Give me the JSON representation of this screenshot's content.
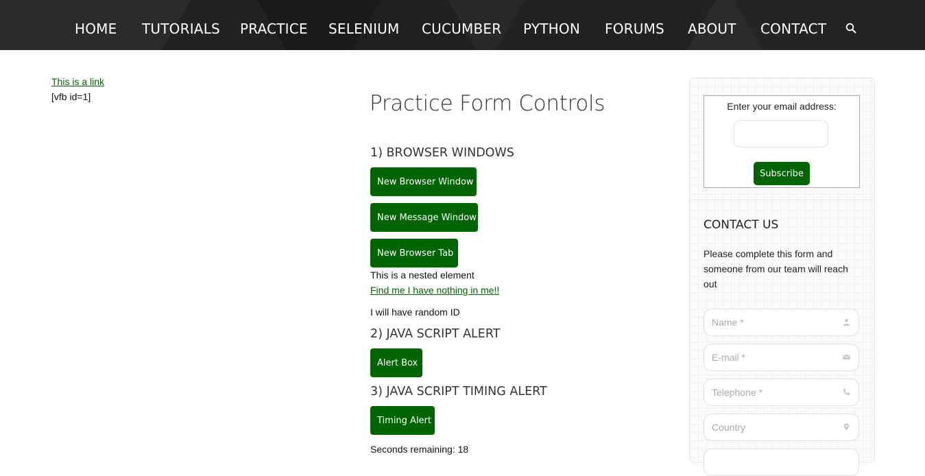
{
  "nav": {
    "items": [
      {
        "label": "HOME"
      },
      {
        "label": "TUTORIALS"
      },
      {
        "label": "PRACTICE"
      },
      {
        "label": "SELENIUM"
      },
      {
        "label": "CUCUMBER"
      },
      {
        "label": "PYTHON"
      },
      {
        "label": "FORUMS"
      },
      {
        "label": "ABOUT"
      },
      {
        "label": "CONTACT"
      }
    ],
    "search_icon": "search-icon"
  },
  "left": {
    "link_text": "This is a link",
    "shortcode_text": "[vfb id=1]"
  },
  "main": {
    "title": "Practice Form Controls",
    "sections": {
      "browser_windows": "1) BROWSER WINDOWS",
      "js_alert": "2) JAVA SCRIPT ALERT",
      "js_timing_alert": "3) JAVA SCRIPT TIMING ALERT"
    },
    "buttons": {
      "new_browser_window": "New Browser Window",
      "new_message_window": "New Message Window",
      "new_browser_tab": "New Browser Tab",
      "alert_box": "Alert Box",
      "timing_alert": "Timing Alert"
    },
    "nested_text": "This is a nested element",
    "find_me_link": "Find me I have nothing in me!!",
    "random_id_text": "I will have random ID",
    "seconds_remaining": "Seconds remaining: 18"
  },
  "sidebar": {
    "subscribe": {
      "label": "Enter your email address:",
      "email_value": "",
      "button": "Subscribe"
    },
    "contact": {
      "title": "CONTACT US",
      "description": "Please complete this form and someone from our team will reach out",
      "fields": [
        {
          "placeholder": "Name *",
          "icon": "user-icon"
        },
        {
          "placeholder": "E-mail *",
          "icon": "envelope-icon"
        },
        {
          "placeholder": "Telephone *",
          "icon": "phone-icon"
        },
        {
          "placeholder": "Country",
          "icon": "map-pin-icon"
        }
      ]
    }
  },
  "colors": {
    "nav_bg": "#222222",
    "accent_green": "#006400",
    "link_green": "#006400"
  }
}
